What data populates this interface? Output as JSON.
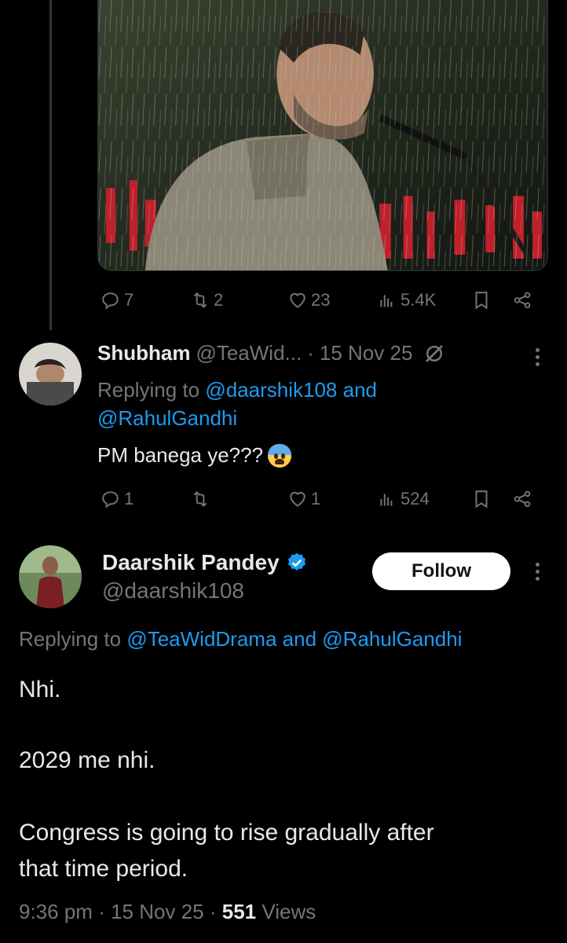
{
  "first_tweet": {
    "actions": {
      "replies": "7",
      "reposts": "2",
      "likes": "23",
      "views": "5.4K"
    }
  },
  "reply": {
    "name": "Shubham",
    "handle": "@TeaWid...",
    "dot": "·",
    "date": "15 Nov 25",
    "replying_prefix": "Replying to",
    "replying_users": [
      "@daarshik108",
      "@RahulGandhi"
    ],
    "replying_and": "and",
    "text": "PM banega ye???",
    "actions": {
      "replies": "1",
      "reposts": "",
      "likes": "1",
      "views": "524"
    }
  },
  "main_tweet": {
    "name": "Daarshik Pandey",
    "handle": "@daarshik108",
    "follow_label": "Follow",
    "replying_prefix": "Replying to",
    "replying_users": [
      "@TeaWidDrama",
      "@RahulGandhi"
    ],
    "replying_and": "and",
    "lines": [
      "Nhi.",
      "2029 me nhi.",
      "Congress is going to rise gradually after",
      "that time period."
    ],
    "time": "9:36 pm",
    "dot": "·",
    "date": "15 Nov 25",
    "views_count": "551",
    "views_label": "Views"
  },
  "colors": {
    "background": "#000000",
    "text": "#e7e9ea",
    "muted": "#71767b",
    "link": "#1d9bf0",
    "verified": "#1d9bf0"
  },
  "icons": [
    "reply-icon",
    "repost-icon",
    "like-icon",
    "views-icon",
    "bookmark-icon",
    "share-icon",
    "verified-badge-icon",
    "grok-icon",
    "more-icon"
  ]
}
